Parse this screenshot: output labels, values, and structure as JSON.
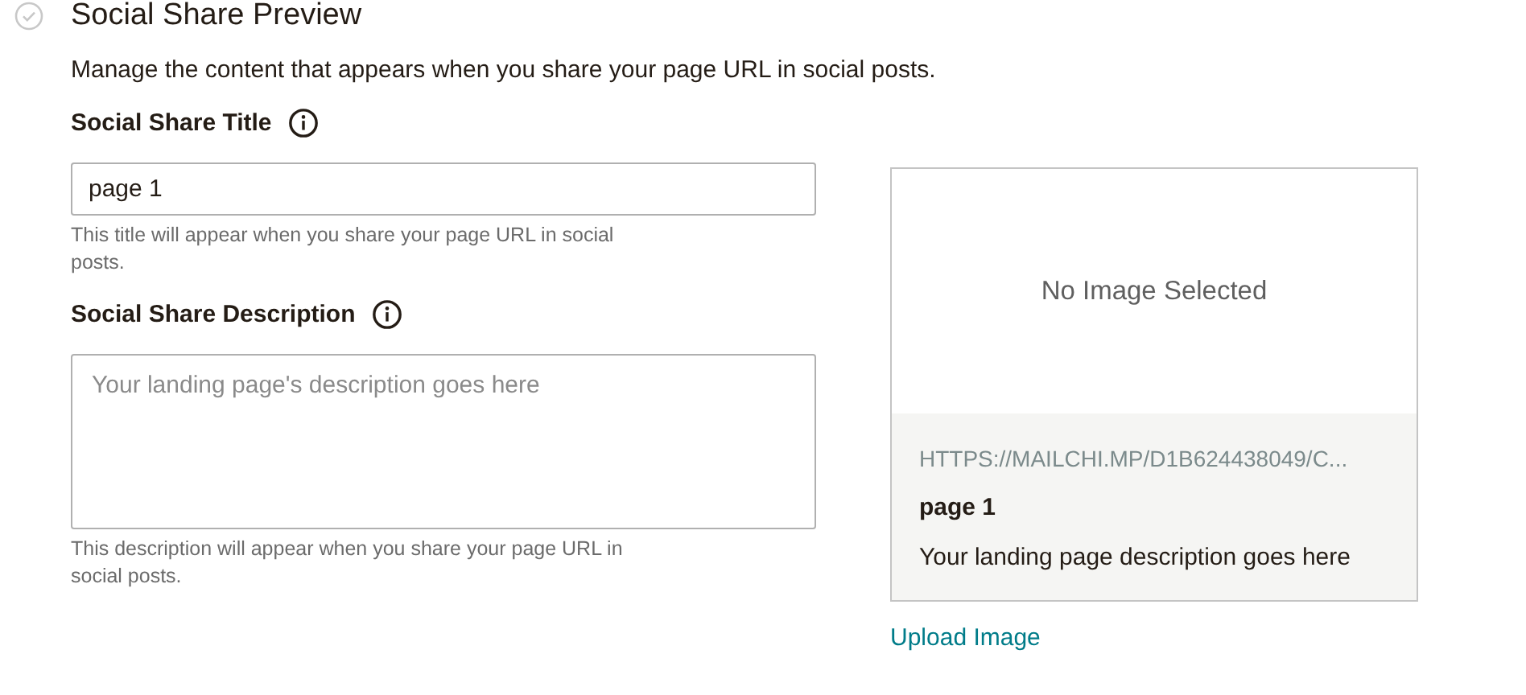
{
  "section": {
    "title": "Social Share Preview",
    "complete": false,
    "description": "Manage the content that appears when you share your page URL in social posts."
  },
  "fields": [
    {
      "kind": "input",
      "label": "Social Share Title",
      "value": "page 1",
      "help": "This title will appear when you share your page URL in social posts."
    },
    {
      "kind": "textarea",
      "label": "Social Share Description",
      "placeholder": "Your landing page's description goes here",
      "help": "This description will appear when you share your page URL in social posts."
    }
  ],
  "preview": {
    "image_text": "No Image Selected",
    "url": "HTTPS://MAILCHI.MP/D1B624438049/C...",
    "title": "page 1",
    "description": "Your landing page description goes here",
    "upload_link": "Upload Image"
  }
}
